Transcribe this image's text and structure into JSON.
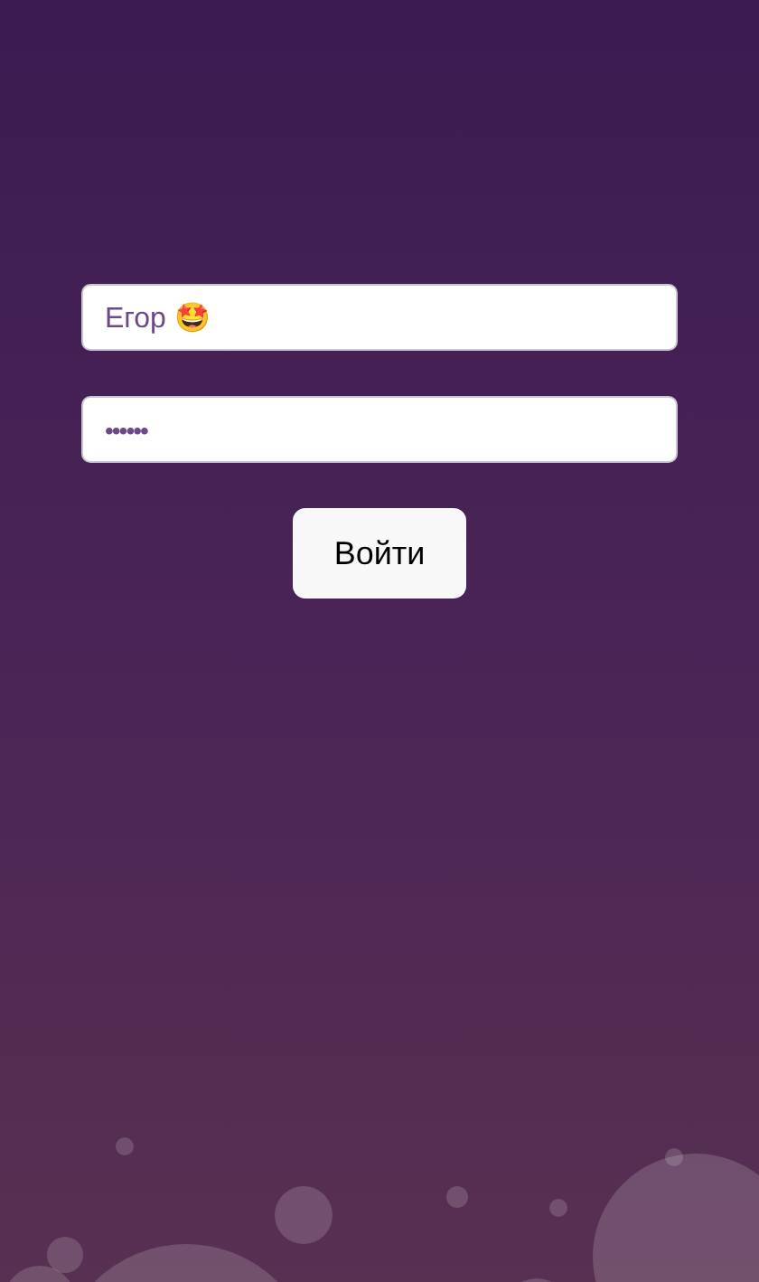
{
  "login_form": {
    "username": {
      "value": "Егор 🤩"
    },
    "password": {
      "value": "••••••"
    },
    "submit_button": {
      "label": "Войти"
    }
  }
}
